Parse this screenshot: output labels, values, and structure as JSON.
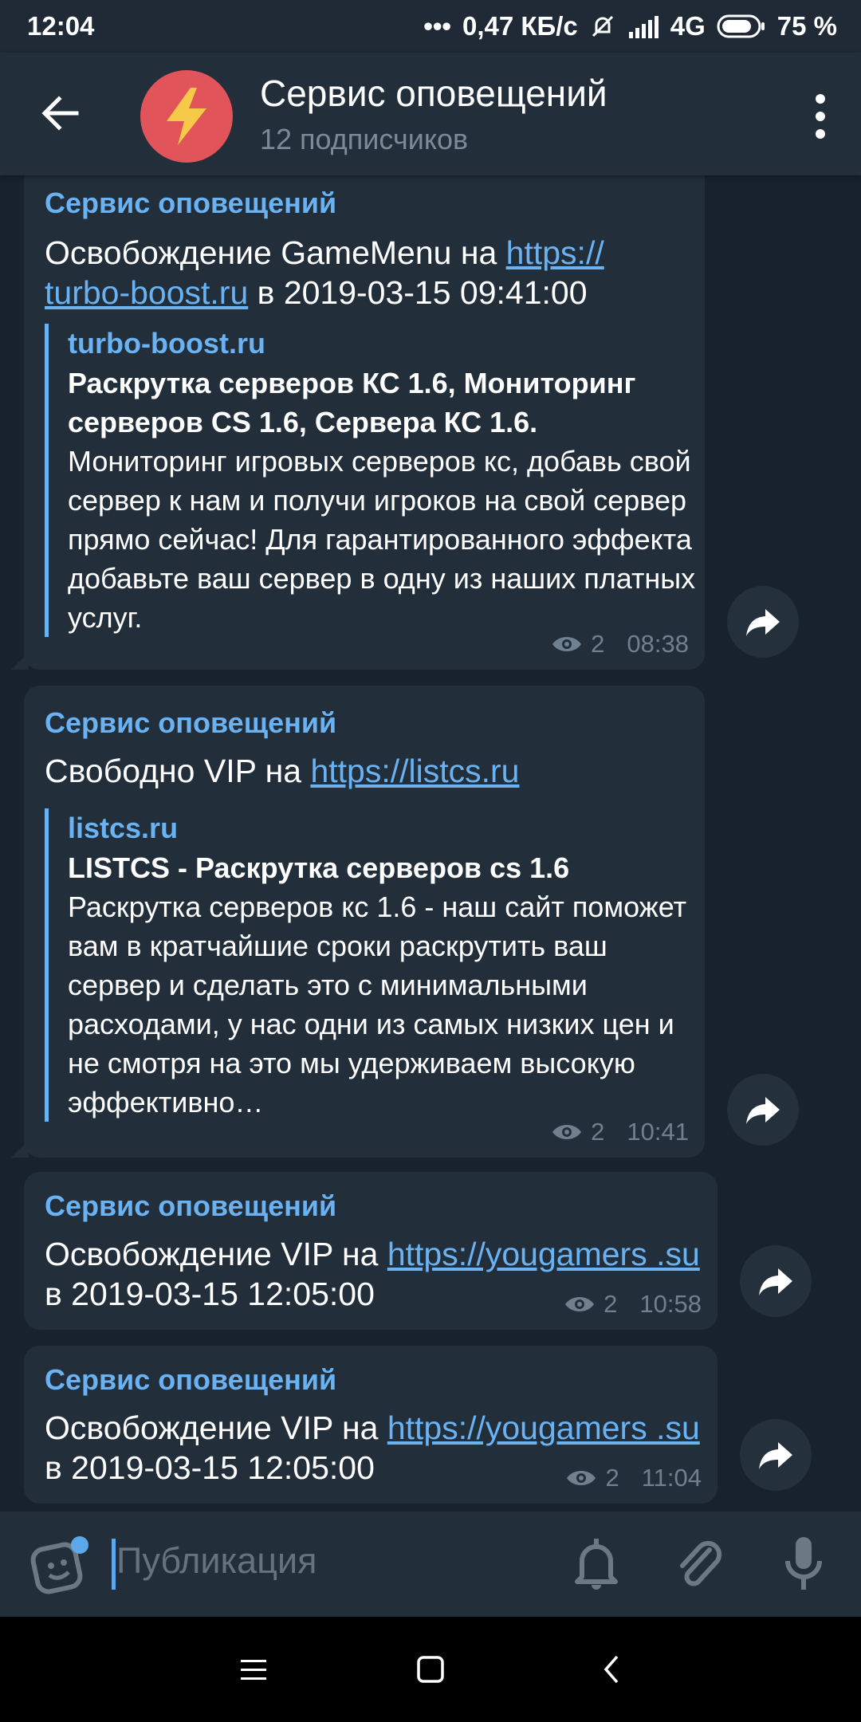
{
  "status": {
    "time": "12:04",
    "dots": "•••",
    "speed": "0,47 КБ/с",
    "network": "4G",
    "battery": "75 %"
  },
  "header": {
    "title": "Сервис оповещений",
    "subtitle": "12 подписчиков"
  },
  "messages": [
    {
      "sender": "Сервис оповещений",
      "text_before": "Освобождение GameMenu на ",
      "link": "https:// turbo-boost.ru",
      "text_after": " в 2019-03-15 09:41:00",
      "preview_site": "turbo-boost.ru",
      "preview_title": "Раскрутка серверов КС 1.6, Мониторинг серверов CS 1.6, Сервера КС 1.6.",
      "preview_desc": "Мониторинг игровых серверов кс, добавь свой сервер к нам и получи игроков на свой сервер прямо сейчас! Для гарантированного эффекта добавьте ваш сервер в одну из наших платных услуг.",
      "views": "2",
      "time": "08:38"
    },
    {
      "sender": "Сервис оповещений",
      "text_before": "Свободно VIP на ",
      "link": "https://listcs.ru",
      "text_after": "",
      "preview_site": "listcs.ru",
      "preview_title": "LISTCS - Раскрутка серверов cs 1.6",
      "preview_desc": "Раскрутка серверов кс 1.6  - наш сайт поможет вам в кратчайшие сроки раскрутить ваш сервер и сделать это с минимальными расходами, у нас одни из самых низких цен и не смотря на это мы удерживаем высокую эффективно…",
      "views": "2",
      "time": "10:41"
    },
    {
      "sender": "Сервис оповещений",
      "text_before": "Освобождение VIP на ",
      "link": "https://yougamers .su",
      "text_after": " в 2019-03-15 12:05:00",
      "views": "2",
      "time": "10:58"
    },
    {
      "sender": "Сервис оповещений",
      "text_before": "Освобождение VIP на ",
      "link": "https://yougamers .su",
      "text_after": " в 2019-03-15 12:05:00",
      "views": "2",
      "time": "11:04"
    }
  ],
  "input": {
    "placeholder": "Публикация"
  },
  "icons": {
    "back": "arrow-left-icon",
    "avatar": "lightning-bolt-icon",
    "menu": "more-vertical-icon",
    "views": "eye-icon",
    "forward": "share-arrow-icon",
    "sticker": "sticker-icon",
    "bell": "bell-icon",
    "attach": "paperclip-icon",
    "mic": "microphone-icon",
    "nav_menu": "menu-lines-icon",
    "nav_home": "square-icon",
    "nav_back": "chevron-left-icon"
  },
  "colors": {
    "accent": "#6ab2f2",
    "bubble": "#222e3a",
    "chat_bg": "#18222d",
    "avatar": "#e0545a",
    "notif_dot": "#5ca8ea"
  }
}
